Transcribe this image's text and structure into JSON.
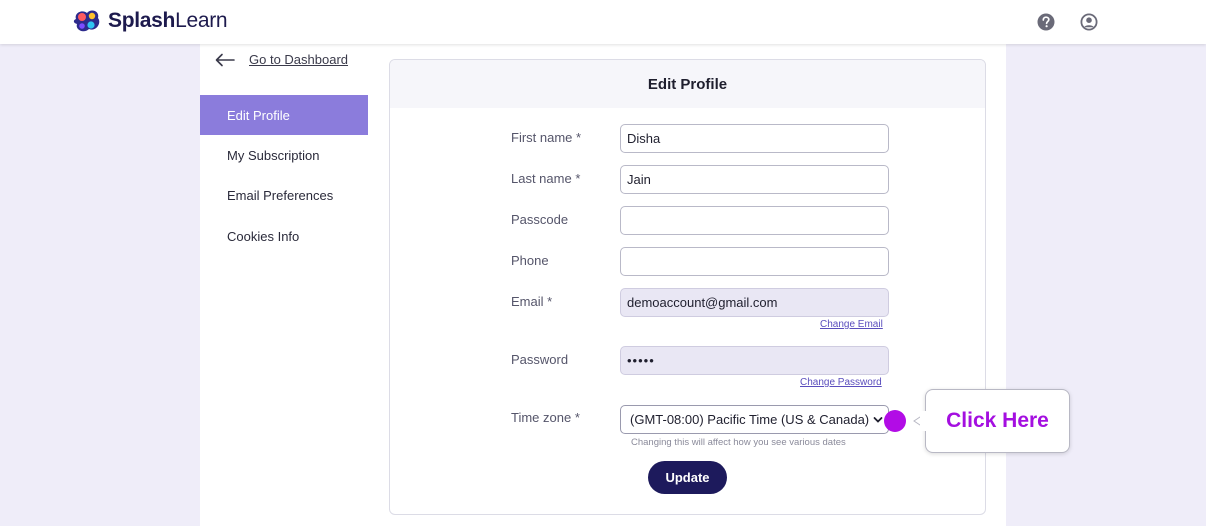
{
  "brand": {
    "name_bold": "Splash",
    "name_light": "Learn"
  },
  "header": {
    "icons": [
      "help-icon",
      "account-icon"
    ]
  },
  "sidebar": {
    "back_label": "Go to Dashboard",
    "items": [
      {
        "label": "Edit Profile",
        "active": true
      },
      {
        "label": "My Subscription",
        "active": false
      },
      {
        "label": "Email Preferences",
        "active": false
      },
      {
        "label": "Cookies Info",
        "active": false
      }
    ]
  },
  "form": {
    "title": "Edit Profile",
    "first_name": {
      "label": "First name *",
      "value": "Disha"
    },
    "last_name": {
      "label": "Last name *",
      "value": "Jain"
    },
    "passcode": {
      "label": "Passcode",
      "value": ""
    },
    "phone": {
      "label": "Phone",
      "value": ""
    },
    "email": {
      "label": "Email *",
      "value": "demoaccount@gmail.com",
      "change_link": "Change Email"
    },
    "password": {
      "label": "Password",
      "value": "•••••",
      "change_link": "Change Password"
    },
    "timezone": {
      "label": "Time zone *",
      "value": "(GMT-08:00) Pacific Time (US & Canada)",
      "hint": "Changing this will affect how you see various dates"
    },
    "update_label": "Update"
  },
  "callout": {
    "text": "Click Here"
  },
  "colors": {
    "accent": "#8b7cdc",
    "primary_button": "#1d1a5c",
    "highlight": "#b20ce6",
    "background": "#efedf9"
  }
}
